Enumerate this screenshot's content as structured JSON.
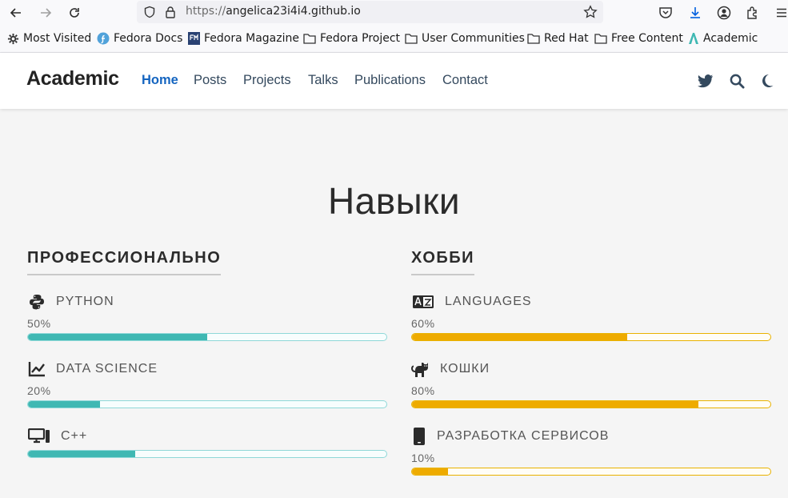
{
  "browser": {
    "url_proto": "https://",
    "url_host": "angelica23i4i4.github.io"
  },
  "bookmarks": [
    {
      "label": "Most Visited",
      "icon": "gear-icon"
    },
    {
      "label": "Fedora Docs",
      "icon": "fedora-icon"
    },
    {
      "label": "Fedora Magazine",
      "icon": "fedora-magazine-icon"
    },
    {
      "label": "Fedora Project",
      "icon": "folder-icon"
    },
    {
      "label": "User Communities",
      "icon": "folder-icon"
    },
    {
      "label": "Red Hat",
      "icon": "folder-icon"
    },
    {
      "label": "Free Content",
      "icon": "folder-icon"
    },
    {
      "label": "Academic",
      "icon": "academic-icon"
    }
  ],
  "site": {
    "brand": "Academic",
    "nav": [
      "Home",
      "Posts",
      "Projects",
      "Talks",
      "Publications",
      "Contact"
    ],
    "active_nav": "Home"
  },
  "section": {
    "title": "Навыки"
  },
  "columns": [
    {
      "heading": "ПРОФЕССИОНАЛЬНО",
      "color": "#3fb8b3",
      "skills": [
        {
          "name": "PYTHON",
          "percent_label": "50%",
          "percent": 50,
          "icon": "python-icon"
        },
        {
          "name": "DATA SCIENCE",
          "percent_label": "20%",
          "percent": 20,
          "icon": "chart-line-icon"
        },
        {
          "name": "C++",
          "percent_label": "",
          "percent": 30,
          "icon": "desktop-icon"
        }
      ]
    },
    {
      "heading": "ХОББИ",
      "color": "#eeab00",
      "skills": [
        {
          "name": "LANGUAGES",
          "percent_label": "60%",
          "percent": 60,
          "icon": "language-icon"
        },
        {
          "name": "КОШКИ",
          "percent_label": "80%",
          "percent": 80,
          "icon": "cat-icon"
        },
        {
          "name": "РАЗРАБОТКА СЕРВИСОВ",
          "percent_label": "10%",
          "percent": 10,
          "icon": "mobile-icon"
        }
      ]
    }
  ]
}
